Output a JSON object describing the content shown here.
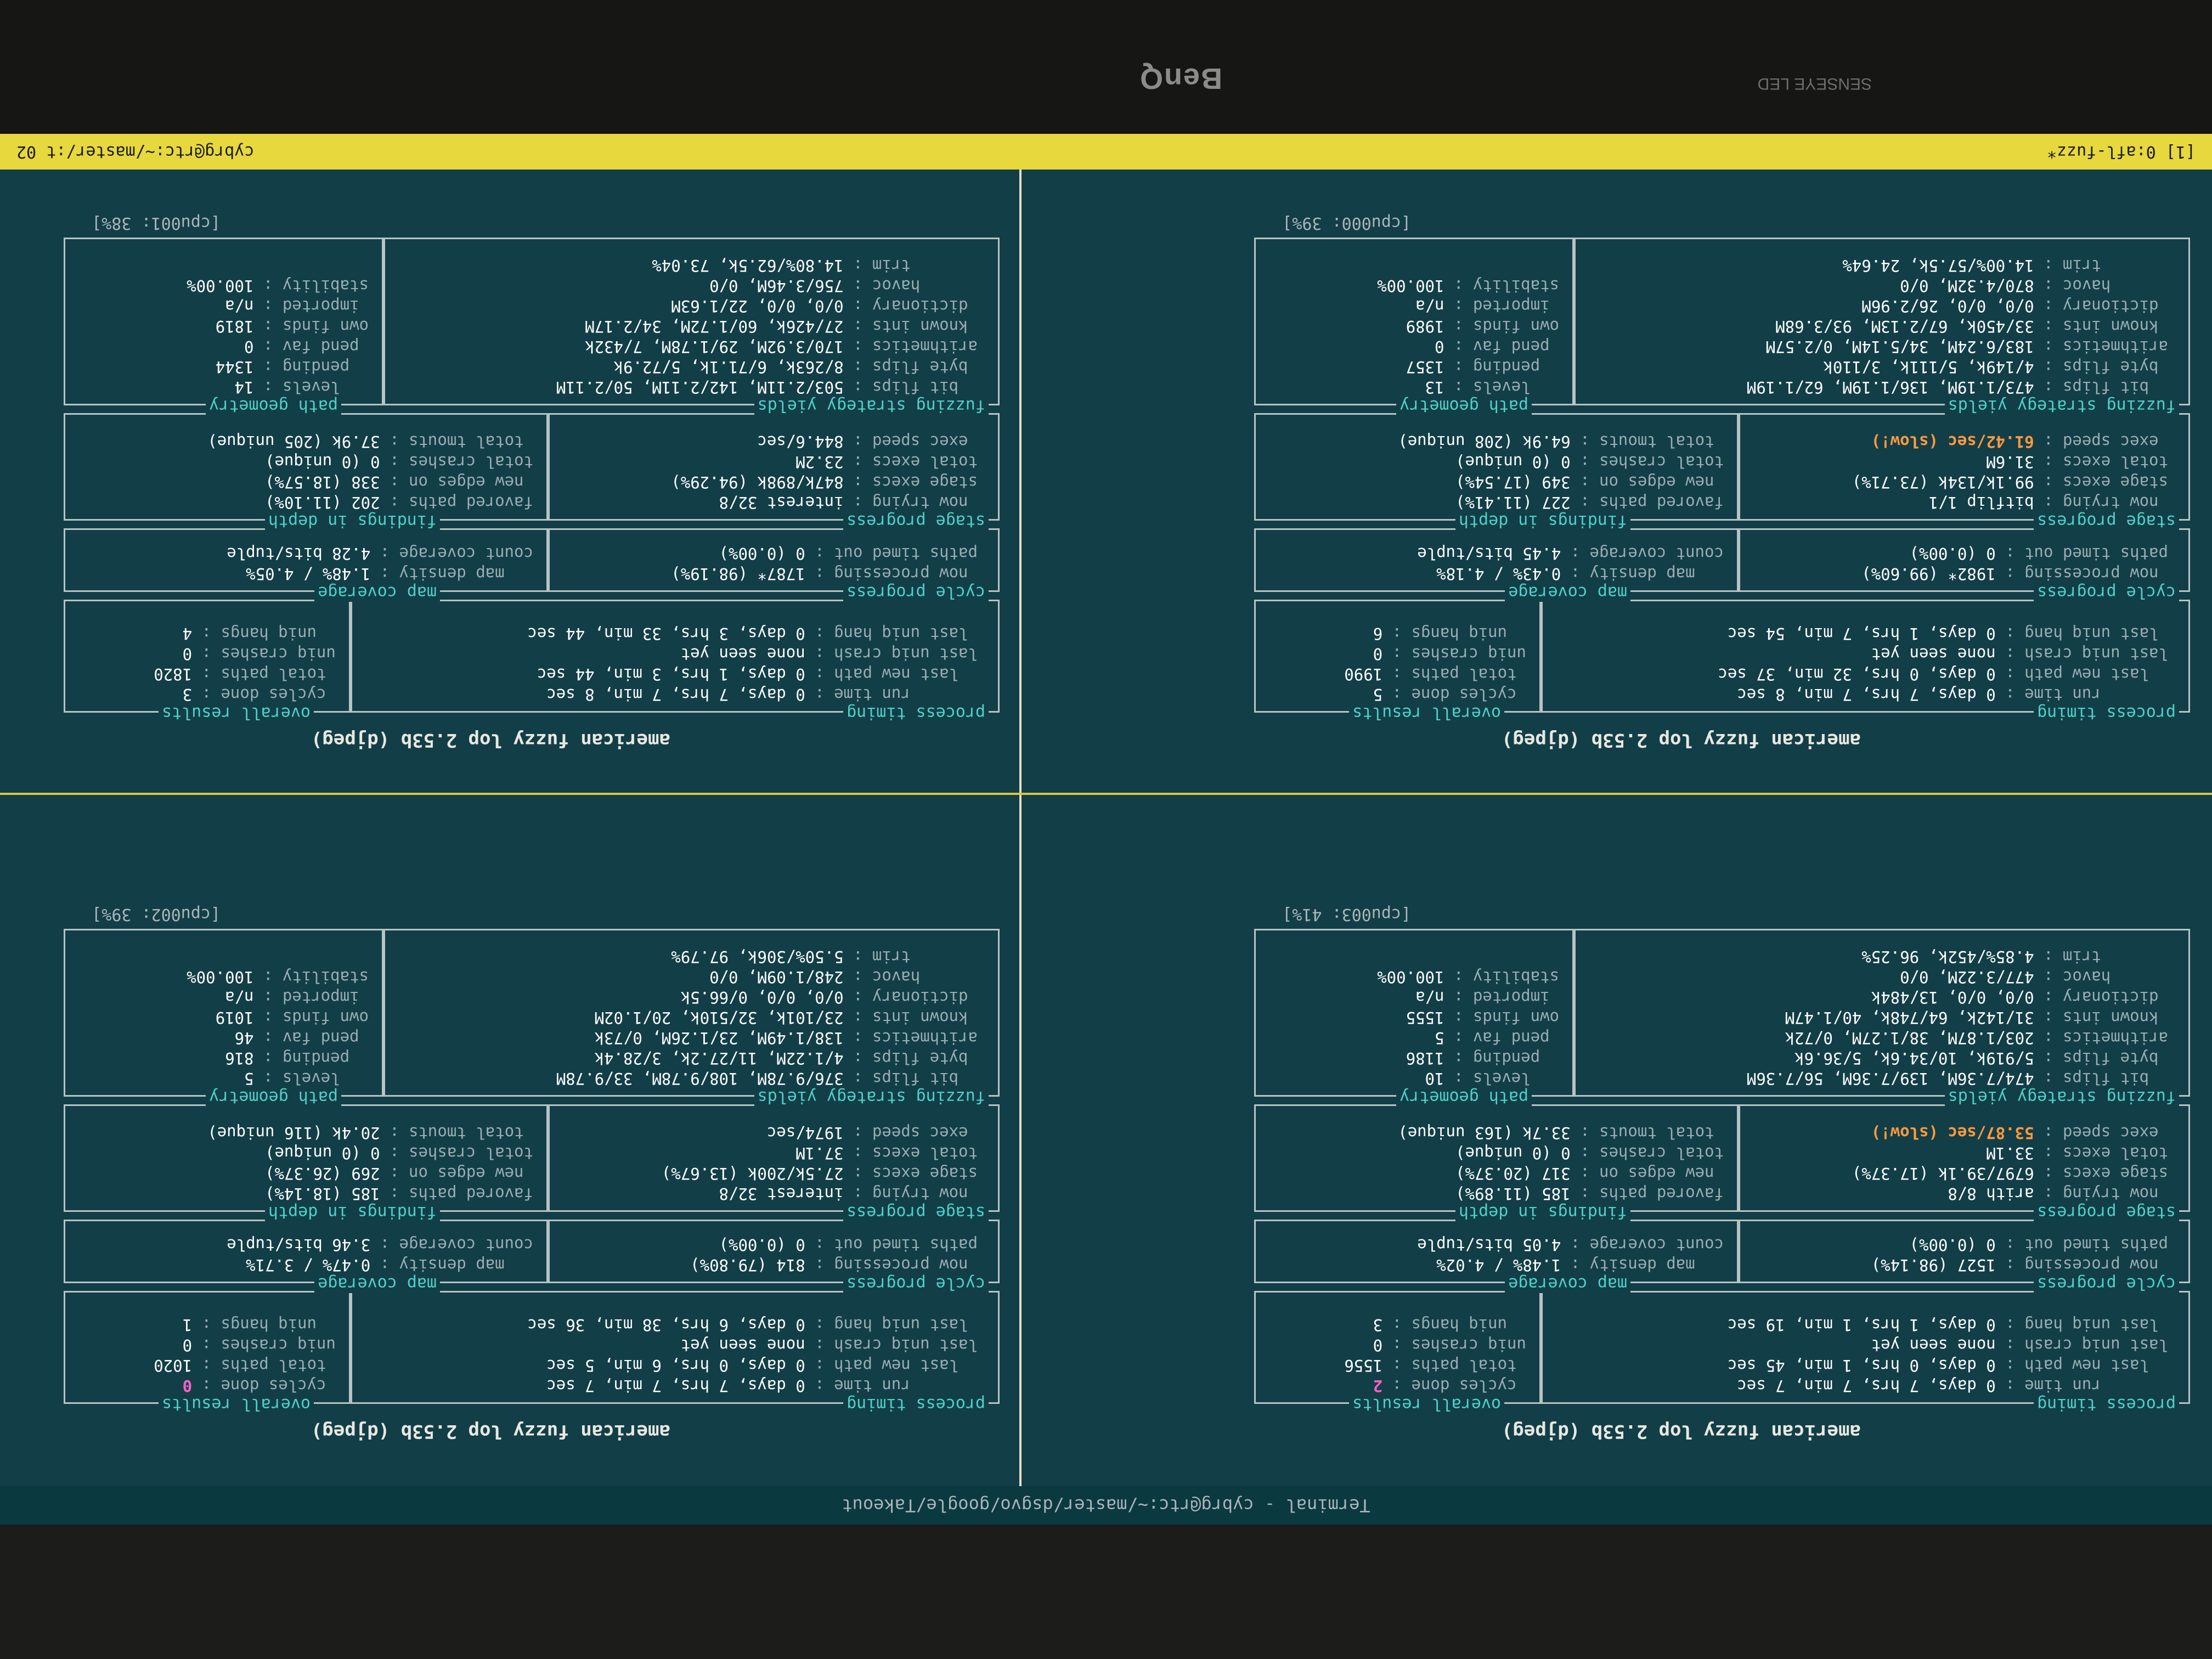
{
  "monitor": {
    "brand": "BenQ",
    "led_label": "SENSEYE LED"
  },
  "window": {
    "title": "Terminal - cybrg@rtc:~/master/dsgvo/google/Takeout"
  },
  "tmux": {
    "left": "[1] 0:afl-fuzz*",
    "right": "cybrg@rtc:~/master/:t 02"
  },
  "panes": [
    {
      "id": "pane-1",
      "title": "american fuzzy lop 2.53b (djpeg)",
      "cpu": "[cpu003: 41%]",
      "process_timing": {
        "label": "process timing",
        "run_time": "0 days, 7 hrs, 7 min, 7 sec",
        "last_new_path": "0 days, 0 hrs, 1 min, 45 sec",
        "last_uniq_crash": "none seen yet",
        "last_uniq_hang": "0 days, 1 hrs, 1 min, 19 sec"
      },
      "overall_results": {
        "label": "overall results",
        "cycles_done": "2",
        "total_paths": "1556",
        "uniq_crashes": "0",
        "uniq_hangs": "3"
      },
      "cycle_progress": {
        "label": "cycle progress",
        "now_processing": "1527 (98.14%)",
        "paths_timed_out": "0 (0.00%)"
      },
      "map_coverage": {
        "label": "map coverage",
        "map_density": "1.48% / 4.02%",
        "count_coverage": "4.05 bits/tuple"
      },
      "stage_progress": {
        "label": "stage progress",
        "now_trying": "arith 8/8",
        "stage_execs": "6797/39.1k (17.37%)",
        "total_execs": "33.1M",
        "exec_speed": "53.87/sec (slow!)"
      },
      "findings": {
        "label": "findings in depth",
        "favored_paths": "185 (11.89%)",
        "new_edges_on": "317 (20.37%)",
        "total_crashes": "0 (0 unique)",
        "total_tmouts": "33.7k (163 unique)"
      },
      "strategy": {
        "label": "fuzzing strategy yields",
        "bit_flips": "474/7.36M, 139/7.36M, 56/7.36M",
        "byte_flips": "5/919k, 10/34.6k, 5/36.6k",
        "arithmetics": "203/1.87M, 38/1.27M, 0/72k",
        "known_ints": "31/142k, 64/748k, 40/1.47M",
        "dictionary": "0/0, 0/0, 13/484k",
        "havoc": "477/3.22M, 0/0",
        "trim": "4.85%/452k, 96.25%"
      },
      "path_geometry": {
        "label": "path geometry",
        "levels": "10",
        "pending": "1186",
        "pend_fav": "5",
        "own_finds": "1555",
        "imported": "n/a",
        "stability": "100.00%"
      }
    },
    {
      "id": "pane-2",
      "title": "american fuzzy lop 2.53b (djpeg)",
      "cpu": "[cpu002: 39%]",
      "process_timing": {
        "label": "process timing",
        "run_time": "0 days, 7 hrs, 7 min, 7 sec",
        "last_new_path": "0 days, 0 hrs, 6 min, 5 sec",
        "last_uniq_crash": "none seen yet",
        "last_uniq_hang": "0 days, 6 hrs, 38 min, 36 sec"
      },
      "overall_results": {
        "label": "overall results",
        "cycles_done": "0",
        "total_paths": "1020",
        "uniq_crashes": "0",
        "uniq_hangs": "1"
      },
      "cycle_progress": {
        "label": "cycle progress",
        "now_processing": "814 (79.80%)",
        "paths_timed_out": "0 (0.00%)"
      },
      "map_coverage": {
        "label": "map coverage",
        "map_density": "0.47% / 3.71%",
        "count_coverage": "3.46 bits/tuple"
      },
      "stage_progress": {
        "label": "stage progress",
        "now_trying": "interest 32/8",
        "stage_execs": "27.5k/200k (13.67%)",
        "total_execs": "37.1M",
        "exec_speed": "1974/sec"
      },
      "findings": {
        "label": "findings in depth",
        "favored_paths": "185 (18.14%)",
        "new_edges_on": "269 (26.37%)",
        "total_crashes": "0 (0 unique)",
        "total_tmouts": "20.4k (116 unique)"
      },
      "strategy": {
        "label": "fuzzing strategy yields",
        "bit_flips": "376/9.78M, 108/9.78M, 33/9.78M",
        "byte_flips": "4/1.22M, 11/27.2k, 3/28.4k",
        "arithmetics": "138/1.49M, 23/1.26M, 0/73k",
        "known_ints": "23/101k, 32/510k, 20/1.02M",
        "dictionary": "0/0, 0/0, 0/66.5k",
        "havoc": "248/1.09M, 0/0",
        "trim": "5.50%/306k, 97.79%"
      },
      "path_geometry": {
        "label": "path geometry",
        "levels": "5",
        "pending": "816",
        "pend_fav": "46",
        "own_finds": "1019",
        "imported": "n/a",
        "stability": "100.00%"
      }
    },
    {
      "id": "pane-3",
      "title": "american fuzzy lop 2.53b (djpeg)",
      "cpu": "[cpu000: 39%]",
      "process_timing": {
        "label": "process timing",
        "run_time": "0 days, 7 hrs, 7 min, 8 sec",
        "last_new_path": "0 days, 0 hrs, 32 min, 37 sec",
        "last_uniq_crash": "none seen yet",
        "last_uniq_hang": "0 days, 1 hrs, 7 min, 54 sec"
      },
      "overall_results": {
        "label": "overall results",
        "cycles_done": "5",
        "total_paths": "1990",
        "uniq_crashes": "0",
        "uniq_hangs": "6"
      },
      "cycle_progress": {
        "label": "cycle progress",
        "now_processing": "1982* (99.60%)",
        "paths_timed_out": "0 (0.00%)"
      },
      "map_coverage": {
        "label": "map coverage",
        "map_density": "0.43% / 4.18%",
        "count_coverage": "4.45 bits/tuple"
      },
      "stage_progress": {
        "label": "stage progress",
        "now_trying": "bitflip 1/1",
        "stage_execs": "99.1k/134k (73.71%)",
        "total_execs": "31.6M",
        "exec_speed": "61.42/sec (slow!)"
      },
      "findings": {
        "label": "findings in depth",
        "favored_paths": "227 (11.41%)",
        "new_edges_on": "349 (17.54%)",
        "total_crashes": "0 (0 unique)",
        "total_tmouts": "64.9k (208 unique)"
      },
      "strategy": {
        "label": "fuzzing strategy yields",
        "bit_flips": "473/1.19M, 136/1.19M, 62/1.19M",
        "byte_flips": "4/149k, 5/111k, 3/110k",
        "arithmetics": "183/6.24M, 34/5.14M, 0/2.57M",
        "known_ints": "33/450k, 67/2.13M, 93/3.68M",
        "dictionary": "0/0, 0/0, 26/2.96M",
        "havoc": "870/4.32M, 0/0",
        "trim": "14.00%/57.5k, 24.64%"
      },
      "path_geometry": {
        "label": "path geometry",
        "levels": "13",
        "pending": "1357",
        "pend_fav": "0",
        "own_finds": "1989",
        "imported": "n/a",
        "stability": "100.00%"
      }
    },
    {
      "id": "pane-4",
      "title": "american fuzzy lop 2.53b (djpeg)",
      "cpu": "[cpu001: 38%]",
      "process_timing": {
        "label": "process timing",
        "run_time": "0 days, 7 hrs, 7 min, 8 sec",
        "last_new_path": "0 days, 1 hrs, 3 min, 44 sec",
        "last_uniq_crash": "none seen yet",
        "last_uniq_hang": "0 days, 3 hrs, 33 min, 44 sec"
      },
      "overall_results": {
        "label": "overall results",
        "cycles_done": "3",
        "total_paths": "1820",
        "uniq_crashes": "0",
        "uniq_hangs": "4"
      },
      "cycle_progress": {
        "label": "cycle progress",
        "now_processing": "1787* (98.19%)",
        "paths_timed_out": "0 (0.00%)"
      },
      "map_coverage": {
        "label": "map coverage",
        "map_density": "1.48% / 4.05%",
        "count_coverage": "4.28 bits/tuple"
      },
      "stage_progress": {
        "label": "stage progress",
        "now_trying": "interest 32/8",
        "stage_execs": "847k/898k (94.29%)",
        "total_execs": "23.2M",
        "exec_speed": "844.6/sec"
      },
      "findings": {
        "label": "findings in depth",
        "favored_paths": "202 (11.10%)",
        "new_edges_on": "338 (18.57%)",
        "total_crashes": "0 (0 unique)",
        "total_tmouts": "37.9k (205 unique)"
      },
      "strategy": {
        "label": "fuzzing strategy yields",
        "bit_flips": "503/2.11M, 142/2.11M, 50/2.11M",
        "byte_flips": "8/263k, 6/71.1k, 5/72.9k",
        "arithmetics": "170/3.92M, 29/1.78M, 7/432k",
        "known_ints": "27/426k, 60/1.72M, 34/2.17M",
        "dictionary": "0/0, 0/0, 22/1.63M",
        "havoc": "756/3.46M, 0/0",
        "trim": "14.80%/62.5k, 73.04%"
      },
      "path_geometry": {
        "label": "path geometry",
        "levels": "14",
        "pending": "1344",
        "pend_fav": "0",
        "own_finds": "1819",
        "imported": "n/a",
        "stability": "100.00%"
      }
    }
  ]
}
